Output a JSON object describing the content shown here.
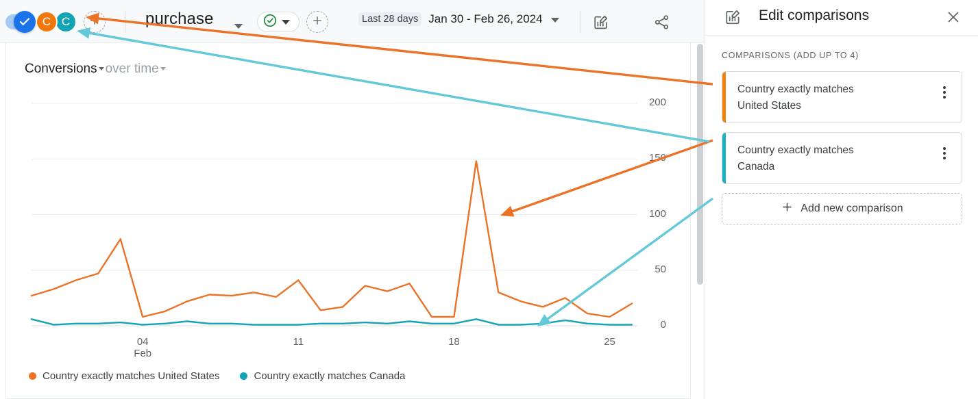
{
  "topbar": {
    "toggle": {
      "name": "comparisons-toggle",
      "state": "on"
    },
    "avatars": [
      {
        "label": "C",
        "color": "#f2770a",
        "name": "comparison-chip-united-states"
      },
      {
        "label": "C",
        "color": "#12a4b4",
        "name": "comparison-chip-canada"
      }
    ],
    "add_comparison_label": "+",
    "event_name": "purchase",
    "event_caret": "chevron-down-icon",
    "check_status_icon": "check-circle-icon",
    "add_event_label": "+",
    "date_chip": "Last 28 days",
    "date_range": "Jan 30 - Feb 26, 2024",
    "icons": {
      "edit_comparisons": "edit-comparisons-icon",
      "share": "share-icon",
      "insights": "insights-icon"
    }
  },
  "card": {
    "title_main": "Conversions",
    "title_sub": "over time"
  },
  "legend": [
    {
      "label": "Country exactly matches United States",
      "color": "#ea7327"
    },
    {
      "label": "Country exactly matches Canada",
      "color": "#12a4b4"
    }
  ],
  "panel": {
    "title": "Edit comparisons",
    "head_icon": "edit-comparisons-icon",
    "close_icon": "close-icon",
    "section_label": "COMPARISONS (ADD UP TO 4)",
    "comparisons": [
      {
        "line1": "Country exactly matches",
        "line2": "United States",
        "color": "#f2820d",
        "menu_icon": "more-vert-icon"
      },
      {
        "line1": "Country exactly matches",
        "line2": "Canada",
        "color": "#19b0c4",
        "menu_icon": "more-vert-icon"
      }
    ],
    "add_new_label": "Add new comparison",
    "add_new_icon": "plus-icon"
  },
  "chart_data": {
    "type": "line",
    "title": "Conversions over time",
    "xlabel": "",
    "ylabel": "",
    "ylim": [
      0,
      215
    ],
    "yticks": [
      0,
      50,
      100,
      150,
      200
    ],
    "ytick_labels": [
      "0",
      "50",
      "100",
      "150",
      "200"
    ],
    "grid": true,
    "legend_position": "bottom-left",
    "x": [
      "Jan 30",
      "Jan 31",
      "Feb 01",
      "Feb 02",
      "Feb 03",
      "Feb 04",
      "Feb 05",
      "Feb 06",
      "Feb 07",
      "Feb 08",
      "Feb 09",
      "Feb 10",
      "Feb 11",
      "Feb 12",
      "Feb 13",
      "Feb 14",
      "Feb 15",
      "Feb 16",
      "Feb 17",
      "Feb 18",
      "Feb 19",
      "Feb 20",
      "Feb 21",
      "Feb 22",
      "Feb 23",
      "Feb 24",
      "Feb 25",
      "Feb 26"
    ],
    "xtick_labels": [
      {
        "value": "04",
        "sub": "Feb",
        "index": 5
      },
      {
        "value": "11",
        "sub": "",
        "index": 12
      },
      {
        "value": "18",
        "sub": "",
        "index": 19
      },
      {
        "value": "25",
        "sub": "",
        "index": 26
      }
    ],
    "series": [
      {
        "name": "Country exactly matches United States",
        "color": "#ea7327",
        "values": [
          27,
          33,
          41,
          47,
          78,
          8,
          13,
          22,
          28,
          27,
          30,
          26,
          41,
          14,
          17,
          36,
          31,
          38,
          8,
          8,
          148,
          30,
          22,
          17,
          25,
          11,
          8,
          20
        ]
      },
      {
        "name": "Country exactly matches Canada",
        "color": "#12a4b4",
        "values": [
          6,
          1,
          2,
          2,
          3,
          1,
          2,
          4,
          2,
          2,
          1,
          1,
          1,
          2,
          2,
          3,
          2,
          4,
          2,
          2,
          6,
          1,
          1,
          2,
          5,
          2,
          1,
          1
        ]
      }
    ]
  },
  "annotations": [
    {
      "name": "arrow-us-comparison",
      "color": "#ea7327",
      "from": [
        1040,
        123
      ],
      "to": [
        125,
        25
      ]
    },
    {
      "name": "arrow-us-legend",
      "color": "#ea7327",
      "from": [
        1040,
        205
      ],
      "to": [
        730,
        315
      ]
    },
    {
      "name": "arrow-canada-comparison",
      "color": "#63c8d8",
      "from": [
        1035,
        207
      ],
      "to": [
        112,
        45
      ]
    },
    {
      "name": "arrow-canada-chart",
      "color": "#63c8d8",
      "from": [
        1040,
        290
      ],
      "to": [
        784,
        477
      ]
    }
  ]
}
